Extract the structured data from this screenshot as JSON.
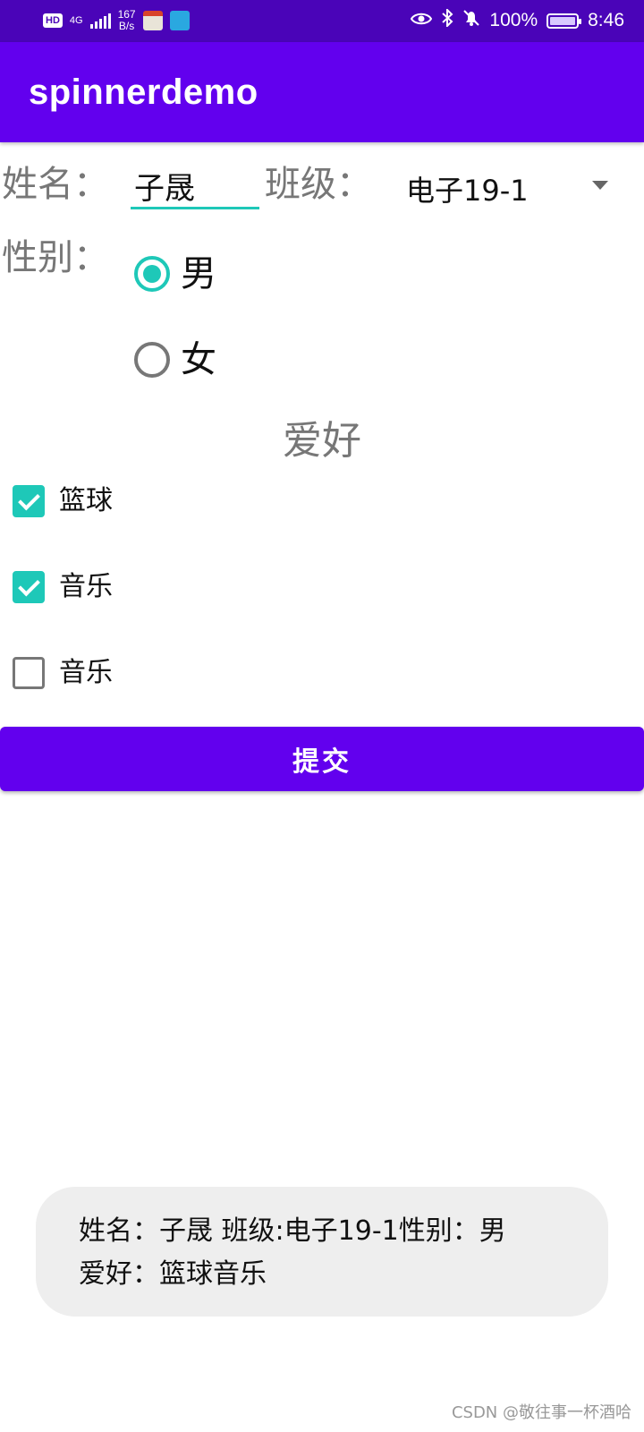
{
  "status_bar": {
    "hd": "HD",
    "network": "4G",
    "speed_value": "167",
    "speed_unit": "B/s",
    "battery": "100%",
    "time": "8:46",
    "icons": [
      "eye-icon",
      "bluetooth-icon",
      "bell-off-icon",
      "battery-charging-icon"
    ]
  },
  "app_bar": {
    "title": "spinnerdemo"
  },
  "form": {
    "name_label": "姓名：",
    "name_value": "子晟",
    "class_label": "班级：",
    "class_selected": "电子19-1",
    "gender_label": "性别：",
    "gender_options": [
      {
        "label": "男",
        "checked": true
      },
      {
        "label": "女",
        "checked": false
      }
    ],
    "hobby_title": "爱好",
    "hobbies": [
      {
        "label": "篮球",
        "checked": true
      },
      {
        "label": "音乐",
        "checked": true
      },
      {
        "label": "音乐",
        "checked": false
      }
    ],
    "submit_label": "提交"
  },
  "toast": {
    "line1": "姓名：子晟    班级:电子19-1性别：男",
    "line2": "爱好：篮球音乐"
  },
  "watermark": "CSDN @敬往事一杯酒哈",
  "colors": {
    "primary": "#6200ee",
    "status_bar": "#4a04b8",
    "accent": "#1ec8b8",
    "toast_bg": "#eeeeee"
  }
}
